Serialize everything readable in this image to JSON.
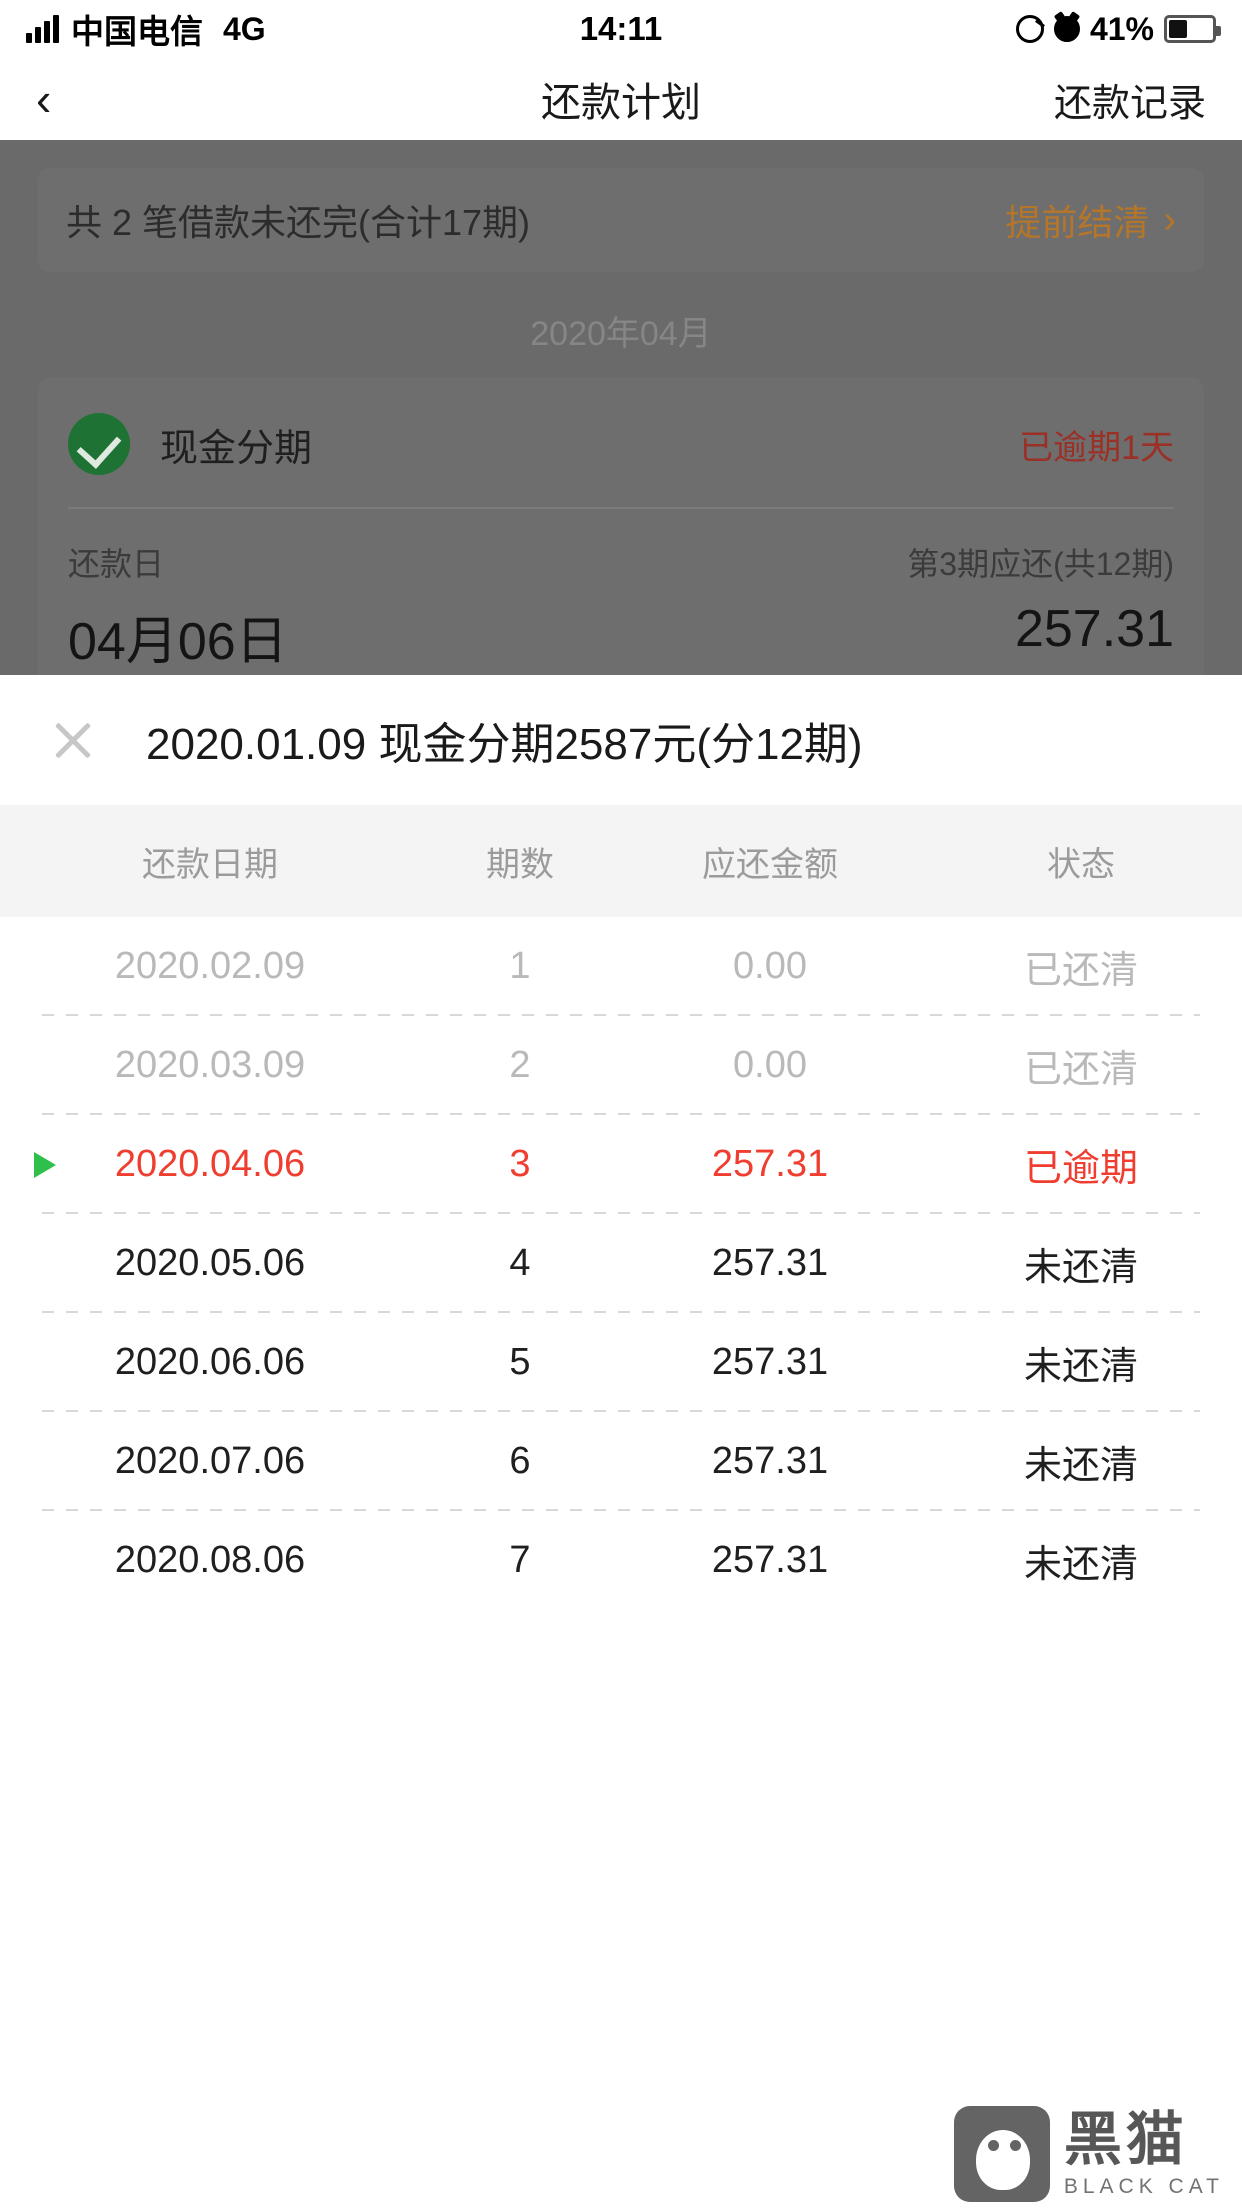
{
  "status_bar": {
    "carrier": "中国电信",
    "network": "4G",
    "time": "14:11",
    "battery_percent": "41%",
    "icons": [
      "signal-icon",
      "rotation-lock-icon",
      "alarm-icon",
      "battery-icon"
    ]
  },
  "nav": {
    "back_icon": "‹",
    "title": "还款计划",
    "right_action": "还款记录"
  },
  "background": {
    "summary": {
      "text": "共 2 笔借款未还完(合计17期)",
      "action_label": "提前结清",
      "action_chevron": "›"
    },
    "month_label": "2020年04月",
    "loan_card": {
      "status_icon": "check-circle-icon",
      "name": "现金分期",
      "overdue_badge": "已逾期1天",
      "date_label": "还款日",
      "date_value": "04月06日",
      "amount_label": "第3期应还(共12期)",
      "amount_value": "257.31",
      "expand_icon": "ˇˇ"
    }
  },
  "sheet": {
    "close_icon": "close-icon",
    "title": "2020.01.09 现金分期2587元(分12期)",
    "table": {
      "columns": [
        "还款日期",
        "期数",
        "应还金额",
        "状态"
      ],
      "rows": [
        {
          "date": "2020.02.09",
          "period": "1",
          "amount": "0.00",
          "status": "已还清",
          "state": "paid",
          "marker": false
        },
        {
          "date": "2020.03.09",
          "period": "2",
          "amount": "0.00",
          "status": "已还清",
          "state": "paid",
          "marker": false
        },
        {
          "date": "2020.04.06",
          "period": "3",
          "amount": "257.31",
          "status": "已逾期",
          "state": "overdue",
          "marker": true
        },
        {
          "date": "2020.05.06",
          "period": "4",
          "amount": "257.31",
          "status": "未还清",
          "state": "unpaid",
          "marker": false
        },
        {
          "date": "2020.06.06",
          "period": "5",
          "amount": "257.31",
          "status": "未还清",
          "state": "unpaid",
          "marker": false
        },
        {
          "date": "2020.07.06",
          "period": "6",
          "amount": "257.31",
          "status": "未还清",
          "state": "unpaid",
          "marker": false
        },
        {
          "date": "2020.08.06",
          "period": "7",
          "amount": "257.31",
          "status": "未还清",
          "state": "unpaid",
          "marker": false
        }
      ]
    }
  },
  "watermark": {
    "cn": "黑猫",
    "en": "BLACK CAT"
  },
  "colors": {
    "accent_orange": "#b5762a",
    "overdue_red": "#ef3e30",
    "paid_gray": "#b9b9b9",
    "check_green": "#1d7234",
    "marker_green": "#2ec04a"
  }
}
